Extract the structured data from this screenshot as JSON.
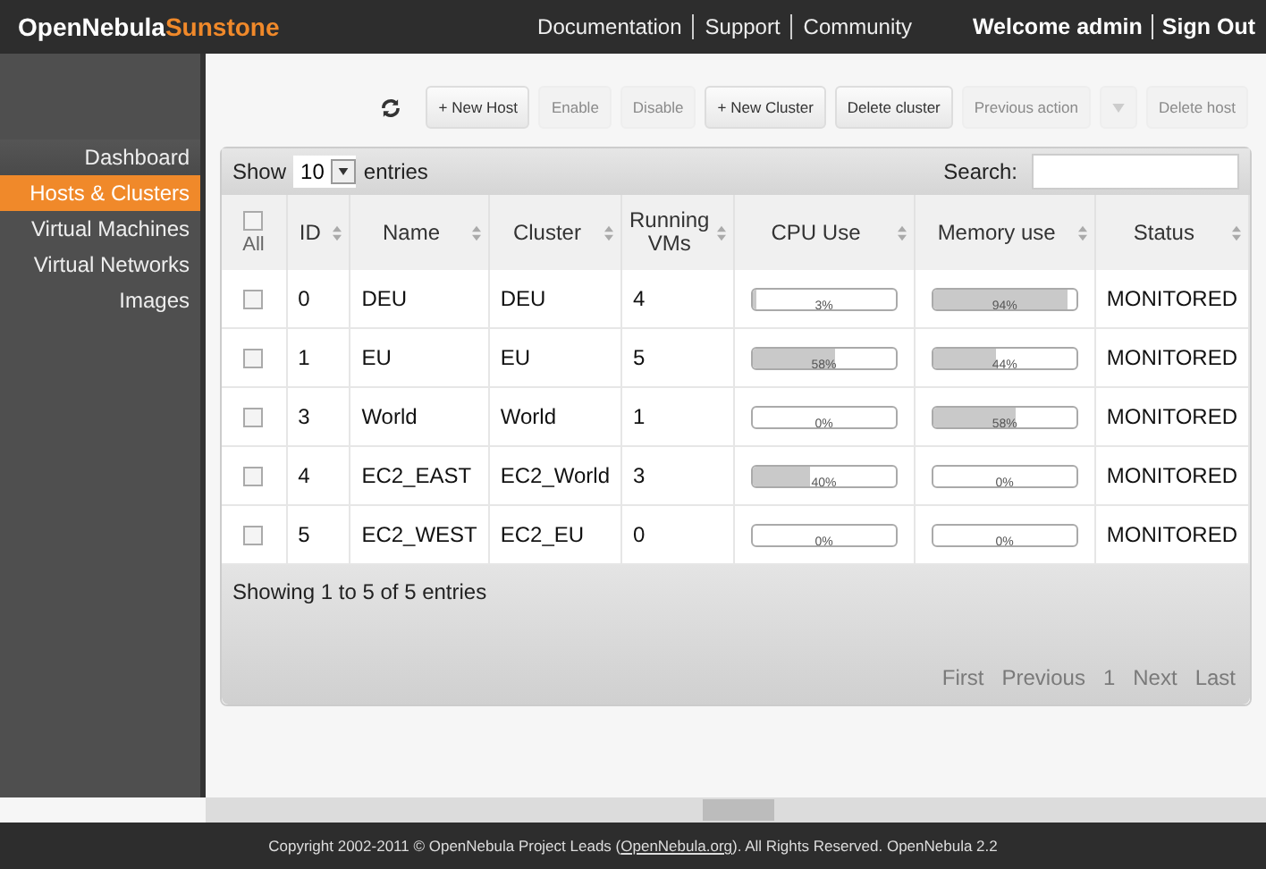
{
  "header": {
    "brand": "OpenNebula",
    "brand_accent": "Sunstone",
    "links": [
      "Documentation",
      "Support",
      "Community"
    ],
    "welcome": "Welcome admin",
    "sign_out": "Sign Out"
  },
  "sidebar": {
    "items": [
      {
        "label": "Dashboard",
        "selected": false
      },
      {
        "label": "Hosts & Clusters",
        "selected": true
      },
      {
        "label": "Virtual Machines",
        "selected": false
      },
      {
        "label": "Virtual Networks",
        "selected": false
      },
      {
        "label": "Images",
        "selected": false
      }
    ]
  },
  "toolbar": [
    {
      "kind": "refresh"
    },
    {
      "kind": "button",
      "label": "+ New Host",
      "disabled": false
    },
    {
      "kind": "button",
      "label": "Enable",
      "disabled": true
    },
    {
      "kind": "button",
      "label": "Disable",
      "disabled": true
    },
    {
      "kind": "button",
      "label": "+ New Cluster",
      "disabled": false
    },
    {
      "kind": "button",
      "label": "Delete cluster",
      "disabled": false
    },
    {
      "kind": "button",
      "label": "Previous action",
      "disabled": true
    },
    {
      "kind": "caret",
      "disabled": true
    },
    {
      "kind": "button",
      "label": "Delete host",
      "disabled": true
    }
  ],
  "table_controls": {
    "show": "Show",
    "page_size": "10",
    "entries": "entries",
    "search_label": "Search:"
  },
  "table": {
    "select_all": {
      "label": "All",
      "checked": false
    },
    "columns": [
      "ID",
      "Name",
      "Cluster",
      "Running VMs",
      "CPU Use",
      "Memory use",
      "Status"
    ],
    "rows": [
      {
        "checked": false,
        "id": "0",
        "name": "DEU",
        "cluster": "DEU",
        "running_vms": "4",
        "cpu": {
          "level": 0.03,
          "reading": "3%"
        },
        "memory": {
          "level": 0.94,
          "reading": "94%"
        },
        "status": "MONITORED"
      },
      {
        "checked": false,
        "id": "1",
        "name": "EU",
        "cluster": "EU",
        "running_vms": "5",
        "cpu": {
          "level": 0.58,
          "reading": "58%"
        },
        "memory": {
          "level": 0.44,
          "reading": "44%"
        },
        "status": "MONITORED"
      },
      {
        "checked": false,
        "id": "3",
        "name": "World",
        "cluster": "World",
        "running_vms": "1",
        "cpu": {
          "level": 0,
          "reading": "0%"
        },
        "memory": {
          "level": 0.58,
          "reading": "58%"
        },
        "status": "MONITORED"
      },
      {
        "checked": false,
        "id": "4",
        "name": "EC2_EAST",
        "cluster": "EC2_World",
        "running_vms": "3",
        "cpu": {
          "level": 0.4,
          "reading": "40%"
        },
        "memory": {
          "level": 0,
          "reading": "0%"
        },
        "status": "MONITORED"
      },
      {
        "checked": false,
        "id": "5",
        "name": "EC2_WEST",
        "cluster": "EC2_EU",
        "running_vms": "0",
        "cpu": {
          "level": 0,
          "reading": "0%"
        },
        "memory": {
          "level": 0,
          "reading": "0%"
        },
        "status": "MONITORED"
      }
    ]
  },
  "table_info": "Showing 1 to 5 of 5 entries",
  "pagination": [
    {
      "label": "First",
      "disabled": true
    },
    {
      "label": "Previous",
      "disabled": true
    },
    {
      "label": "1",
      "disabled": true
    },
    {
      "label": "Next",
      "disabled": true
    },
    {
      "label": "Last",
      "disabled": true
    }
  ],
  "footer": {
    "text_before": "Copyright 2002-2011 © OpenNebula Project Leads (",
    "link": "OpenNebula.org",
    "text_after": "). All Rights Reserved. OpenNebula 2.2"
  }
}
